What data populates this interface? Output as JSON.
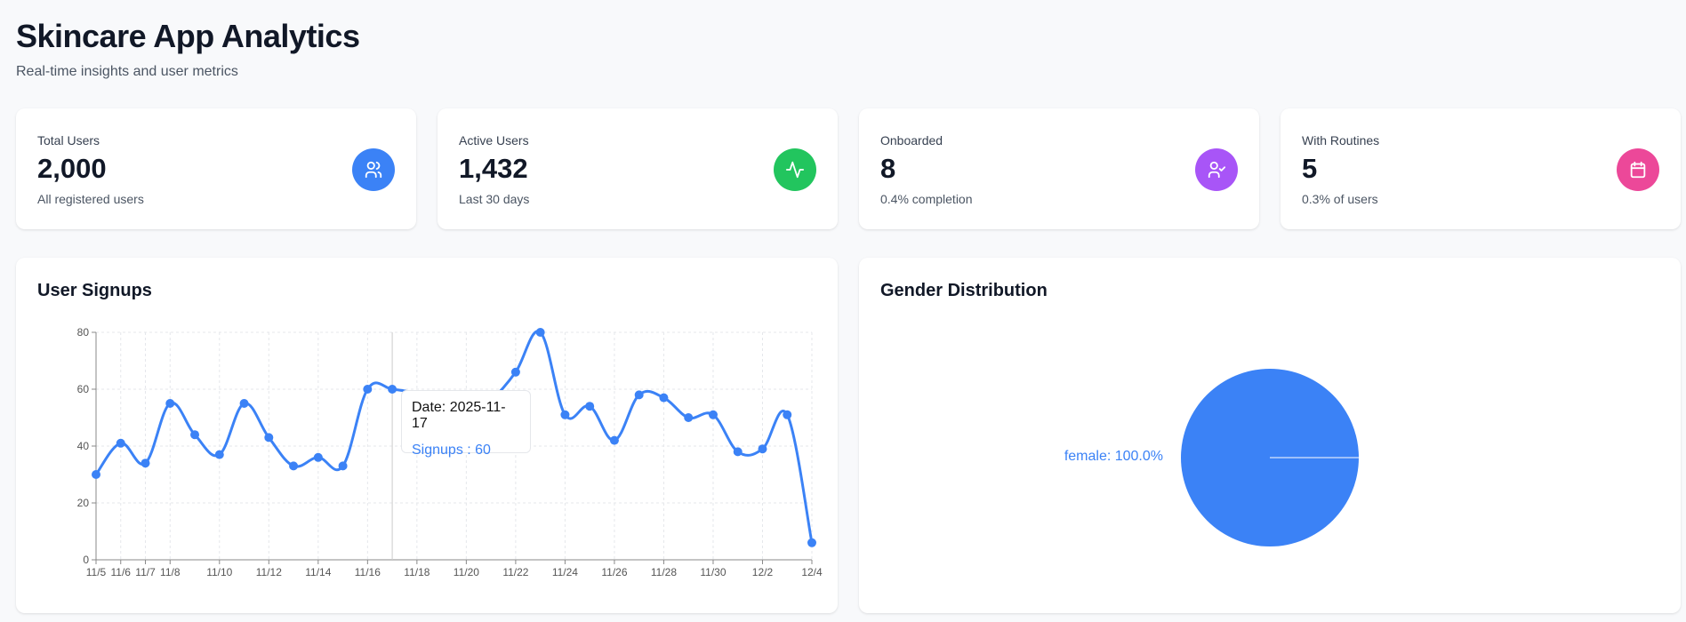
{
  "header": {
    "title": "Skincare App Analytics",
    "subtitle": "Real-time insights and user metrics"
  },
  "stats": [
    {
      "label": "Total Users",
      "value": "2,000",
      "sub": "All registered users",
      "icon": "users-icon",
      "color": "#3b82f6"
    },
    {
      "label": "Active Users",
      "value": "1,432",
      "sub": "Last 30 days",
      "icon": "activity-icon",
      "color": "#22c55e"
    },
    {
      "label": "Onboarded",
      "value": "8",
      "sub": "0.4% completion",
      "icon": "user-check-icon",
      "color": "#a855f7"
    },
    {
      "label": "With Routines",
      "value": "5",
      "sub": "0.3% of users",
      "icon": "calendar-icon",
      "color": "#ec4899"
    }
  ],
  "signups": {
    "title": "User Signups",
    "tooltip": {
      "date": "Date: 2025-11-17",
      "value": "Signups : 60"
    }
  },
  "gender": {
    "title": "Gender Distribution",
    "label": "female: 100.0%"
  },
  "chart_data": [
    {
      "type": "line",
      "title": "User Signups",
      "color": "#3b82f6",
      "x": [
        "11/5",
        "11/6",
        "11/7",
        "11/8",
        "11/9",
        "11/10",
        "11/11",
        "11/12",
        "11/13",
        "11/14",
        "11/15",
        "11/16",
        "11/17",
        "11/18",
        "11/19",
        "11/20",
        "11/21",
        "11/22",
        "11/23",
        "11/24",
        "11/25",
        "11/26",
        "11/27",
        "11/28",
        "11/29",
        "11/30",
        "12/1",
        "12/2",
        "12/3",
        "12/4"
      ],
      "x_ticks": [
        "11/5",
        "11/6",
        "11/7",
        "11/8",
        "11/10",
        "11/12",
        "11/14",
        "11/16",
        "11/18",
        "11/20",
        "11/22",
        "11/24",
        "11/26",
        "11/28",
        "11/30",
        "12/2",
        "12/4"
      ],
      "series": [
        {
          "name": "Signups",
          "values": [
            30,
            41,
            34,
            55,
            44,
            37,
            55,
            43,
            33,
            36,
            33,
            60,
            60,
            58,
            52,
            50,
            56,
            66,
            80,
            51,
            54,
            42,
            58,
            57,
            50,
            51,
            38,
            39,
            51,
            6
          ]
        }
      ],
      "ylim": [
        0,
        80
      ],
      "y_ticks": [
        0,
        20,
        40,
        60,
        80
      ],
      "grid": true
    },
    {
      "type": "pie",
      "title": "Gender Distribution",
      "slices": [
        {
          "label": "female",
          "value": 100.0,
          "color": "#3b82f6"
        }
      ]
    }
  ]
}
